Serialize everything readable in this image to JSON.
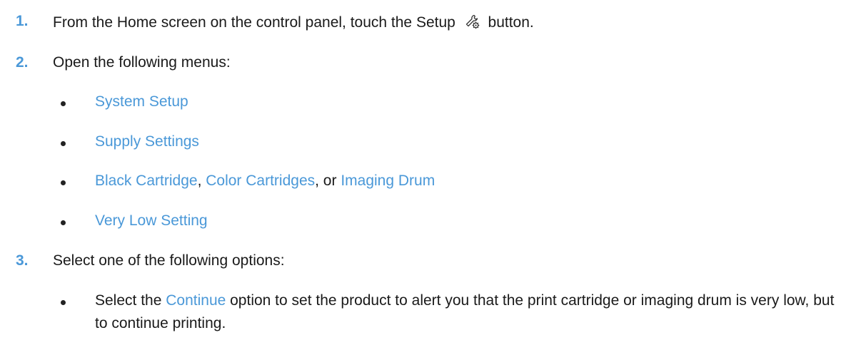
{
  "steps": [
    {
      "num": "1.",
      "text_before": "From the Home screen on the control panel, touch the Setup",
      "icon": "setup-wrench-gear-icon",
      "text_after": "button."
    },
    {
      "num": "2.",
      "text": "Open the following menus:",
      "menus": [
        {
          "label": "System Setup"
        },
        {
          "label": "Supply Settings"
        },
        {
          "label": "Very Low Setting"
        }
      ],
      "cartridge_options": {
        "opt1": "Black Cartridge",
        "sep1": ", ",
        "opt2": "Color Cartridges",
        "sep2": ", or ",
        "opt3": "Imaging Drum"
      }
    },
    {
      "num": "3.",
      "text": "Select one of the following options:",
      "option_bullet": {
        "before": "Select the ",
        "option": "Continue",
        "after": " option to set the product to alert you that the print cartridge or imaging drum is very low, but to continue printing."
      }
    }
  ],
  "colors": {
    "accent": "#4a98d8",
    "text": "#1a1a1a"
  }
}
